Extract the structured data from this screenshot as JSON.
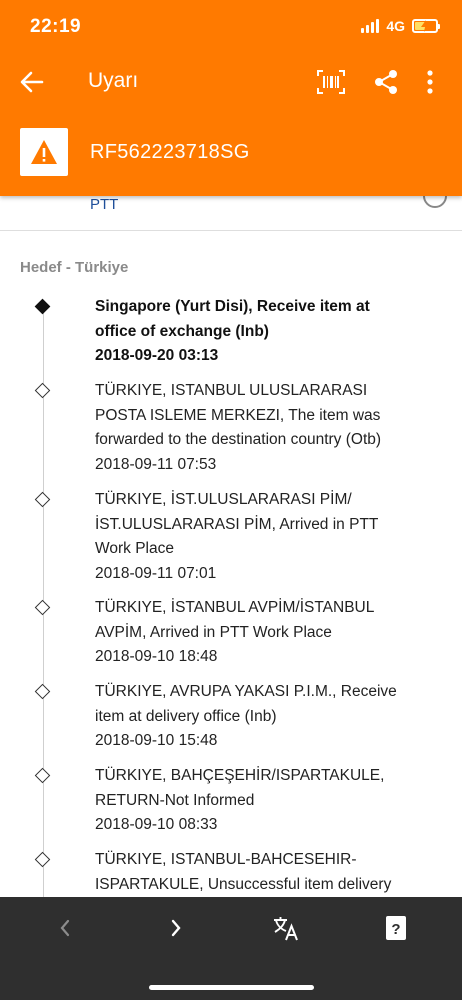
{
  "status_bar": {
    "time": "22:19",
    "network": "4G"
  },
  "toolbar": {
    "title": "Uyarı",
    "back_icon": "arrow-left-icon",
    "actions": [
      "barcode-icon",
      "share-icon",
      "more-vert-icon"
    ]
  },
  "tracking": {
    "number": "RF562223718SG",
    "icon": "warning-icon"
  },
  "carrier_partial": "PTT",
  "section_heading": "Hedef - Türkiye",
  "events": [
    {
      "l1": "Singapore (Yurt Disi), Receive item at",
      "l2": "office of exchange (Inb)",
      "l3": "2018-09-20 03:13",
      "l4": ""
    },
    {
      "l1": "TÜRKIYE, ISTANBUL ULUSLARARASI",
      "l2": "POSTA ISLEME MERKEZI, The item was",
      "l3": "forwarded to the destination country (Otb)",
      "l4": "2018-09-11 07:53"
    },
    {
      "l1": "TÜRKIYE, İST.ULUSLARARASI PİM/",
      "l2": "İST.ULUSLARARASI PİM, Arrived in PTT",
      "l3": "Work Place",
      "l4": "2018-09-11 07:01"
    },
    {
      "l1": "TÜRKIYE, İSTANBUL AVPİM/İSTANBUL",
      "l2": "AVPİM, Arrived in PTT Work Place",
      "l3": "2018-09-10 18:48",
      "l4": ""
    },
    {
      "l1": "TÜRKIYE, AVRUPA YAKASI P.I.M., Receive",
      "l2": "item at delivery office (Inb)",
      "l3": "2018-09-10 15:48",
      "l4": ""
    },
    {
      "l1": "TÜRKIYE, BAHÇEŞEHİR/ISPARTAKULE,",
      "l2": "RETURN-Not Informed",
      "l3": "2018-09-10 08:33",
      "l4": ""
    },
    {
      "l1": "TÜRKIYE, ISTANBUL-BAHCESEHIR-",
      "l2": "ISPARTAKULE, Unsuccessful item delivery",
      "l3": "",
      "l4": ""
    }
  ],
  "bottom_bar": {
    "icons": [
      "chevron-left-icon",
      "chevron-right-icon",
      "translate-icon",
      "help-card-icon"
    ]
  },
  "colors": {
    "primary": "#ff7a00",
    "bottom_bar": "#2f2f2f",
    "link": "#1f4f9a"
  }
}
